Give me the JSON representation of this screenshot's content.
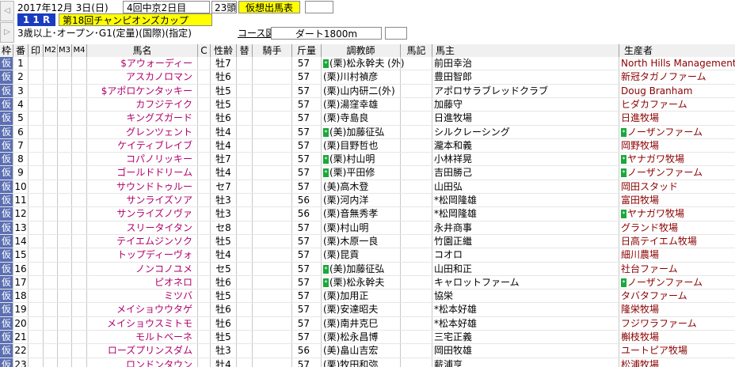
{
  "header": {
    "date": "2017年12月 3日(日)",
    "meeting": "4回中京2日目",
    "count": "23頭",
    "mode_button": "仮想出馬表",
    "race_no": "1 1 R",
    "race_name": "第18回チャンピオンズカップ",
    "conditions": "3歳以上･オープン･G1(定量)(国際)(指定)",
    "course_button": "コース図",
    "course": "ダート1800m"
  },
  "columns": {
    "waku": "枠",
    "ban": "番",
    "shirushi": "印",
    "m2": "M2",
    "m3": "M3",
    "m4": "M4",
    "horse": "馬名",
    "c": "C",
    "sex_age": "性齢",
    "replace": "替",
    "jockey": "騎手",
    "weight": "斤量",
    "trainer": "調教師",
    "banki": "馬記",
    "owner": "馬主",
    "breeder": "生産者"
  },
  "rows": [
    {
      "waku": "仮",
      "no": "1",
      "prefix": "$",
      "horse": "アウォーディー",
      "sex": "牡7",
      "weight": "57",
      "mark": "*",
      "trainer": "(栗)松永幹夫 (外)",
      "owner": "前田幸治",
      "bmark": "",
      "breeder": "North Hills Management"
    },
    {
      "waku": "仮",
      "no": "2",
      "prefix": "",
      "horse": "アスカノロマン",
      "sex": "牡6",
      "weight": "57",
      "mark": "",
      "trainer": "(栗)川村禎彦",
      "owner": "豊田智郎",
      "bmark": "",
      "breeder": "新冠タガノファーム"
    },
    {
      "waku": "仮",
      "no": "3",
      "prefix": "$",
      "horse": "アポロケンタッキー",
      "sex": "牡5",
      "weight": "57",
      "mark": "",
      "trainer": "(栗)山内研二(外)",
      "owner": "アポロサラブレッドクラブ",
      "bmark": "",
      "breeder": "Doug Branham"
    },
    {
      "waku": "仮",
      "no": "4",
      "prefix": "",
      "horse": "カフジテイク",
      "sex": "牡5",
      "weight": "57",
      "mark": "",
      "trainer": "(栗)湯窪幸雄",
      "owner": "加藤守",
      "bmark": "",
      "breeder": "ヒダカファーム"
    },
    {
      "waku": "仮",
      "no": "5",
      "prefix": "",
      "horse": "キングズガード",
      "sex": "牡6",
      "weight": "57",
      "mark": "",
      "trainer": "(栗)寺島良",
      "owner": "日進牧場",
      "bmark": "",
      "breeder": "日進牧場"
    },
    {
      "waku": "仮",
      "no": "6",
      "prefix": "",
      "horse": "グレンツェント",
      "sex": "牡4",
      "weight": "57",
      "mark": "*",
      "trainer": "(美)加藤征弘",
      "owner": "シルクレーシング",
      "bmark": "*",
      "breeder": "ノーザンファーム"
    },
    {
      "waku": "仮",
      "no": "7",
      "prefix": "",
      "horse": "ケイティブレイブ",
      "sex": "牡4",
      "weight": "57",
      "mark": "",
      "trainer": "(栗)目野哲也",
      "owner": "瀧本和義",
      "bmark": "",
      "breeder": "岡野牧場"
    },
    {
      "waku": "仮",
      "no": "8",
      "prefix": "",
      "horse": "コパノリッキー",
      "sex": "牡7",
      "weight": "57",
      "mark": "*",
      "trainer": "(栗)村山明",
      "owner": "小林祥晃",
      "bmark": "*",
      "breeder": "ヤナガワ牧場"
    },
    {
      "waku": "仮",
      "no": "9",
      "prefix": "",
      "horse": "ゴールドドリーム",
      "sex": "牡4",
      "weight": "57",
      "mark": "*",
      "trainer": "(栗)平田修",
      "owner": "吉田勝己",
      "bmark": "*",
      "breeder": "ノーザンファーム"
    },
    {
      "waku": "仮",
      "no": "10",
      "prefix": "",
      "horse": "サウンドトゥルー",
      "sex": "セ7",
      "weight": "57",
      "mark": "",
      "trainer": "(美)高木登",
      "owner": "山田弘",
      "bmark": "",
      "breeder": "岡田スタッド"
    },
    {
      "waku": "仮",
      "no": "11",
      "prefix": "",
      "horse": "サンライズソア",
      "sex": "牡3",
      "weight": "56",
      "mark": "",
      "trainer": "(栗)河内洋",
      "owner": "*松岡隆雄",
      "bmark": "",
      "breeder": "富田牧場"
    },
    {
      "waku": "仮",
      "no": "12",
      "prefix": "",
      "horse": "サンライズノヴァ",
      "sex": "牡3",
      "weight": "56",
      "mark": "",
      "trainer": "(栗)音無秀孝",
      "owner": "*松岡隆雄",
      "bmark": "*",
      "breeder": "ヤナガワ牧場"
    },
    {
      "waku": "仮",
      "no": "13",
      "prefix": "",
      "horse": "スリータイタン",
      "sex": "セ8",
      "weight": "57",
      "mark": "",
      "trainer": "(栗)村山明",
      "owner": "永井商事",
      "bmark": "",
      "breeder": "グランド牧場"
    },
    {
      "waku": "仮",
      "no": "14",
      "prefix": "",
      "horse": "テイエムジンソク",
      "sex": "牡5",
      "weight": "57",
      "mark": "",
      "trainer": "(栗)木原一良",
      "owner": "竹園正繼",
      "bmark": "",
      "breeder": "日高テイエム牧場"
    },
    {
      "waku": "仮",
      "no": "15",
      "prefix": "",
      "horse": "トップディーヴォ",
      "sex": "牡4",
      "weight": "57",
      "mark": "",
      "trainer": "(栗)昆貢",
      "owner": "コオロ",
      "bmark": "",
      "breeder": "細川農場"
    },
    {
      "waku": "仮",
      "no": "16",
      "prefix": "",
      "horse": "ノンコノユメ",
      "sex": "セ5",
      "weight": "57",
      "mark": "*",
      "trainer": "(美)加藤征弘",
      "owner": "山田和正",
      "bmark": "",
      "breeder": "社台ファーム"
    },
    {
      "waku": "仮",
      "no": "17",
      "prefix": "",
      "horse": "ピオネロ",
      "sex": "牡6",
      "weight": "57",
      "mark": "*",
      "trainer": "(栗)松永幹夫",
      "owner": "キャロットファーム",
      "bmark": "*",
      "breeder": "ノーザンファーム"
    },
    {
      "waku": "仮",
      "no": "18",
      "prefix": "",
      "horse": "ミツバ",
      "sex": "牡5",
      "weight": "57",
      "mark": "",
      "trainer": "(栗)加用正",
      "owner": "協栄",
      "bmark": "",
      "breeder": "タバタファーム"
    },
    {
      "waku": "仮",
      "no": "19",
      "prefix": "",
      "horse": "メイショウウタゲ",
      "sex": "牡6",
      "weight": "57",
      "mark": "",
      "trainer": "(栗)安達昭夫",
      "owner": "*松本好雄",
      "bmark": "",
      "breeder": "隆栄牧場"
    },
    {
      "waku": "仮",
      "no": "20",
      "prefix": "",
      "horse": "メイショウスミトモ",
      "sex": "牡6",
      "weight": "57",
      "mark": "",
      "trainer": "(栗)南井克巳",
      "owner": "*松本好雄",
      "bmark": "",
      "breeder": "フジワラファーム"
    },
    {
      "waku": "仮",
      "no": "21",
      "prefix": "",
      "horse": "モルトベーネ",
      "sex": "牡5",
      "weight": "57",
      "mark": "",
      "trainer": "(栗)松永昌博",
      "owner": "三宅正義",
      "bmark": "",
      "breeder": "槲枝牧場"
    },
    {
      "waku": "仮",
      "no": "22",
      "prefix": "",
      "horse": "ローズプリンスダム",
      "sex": "牡3",
      "weight": "56",
      "mark": "",
      "trainer": "(美)畠山吉宏",
      "owner": "岡田牧雄",
      "bmark": "",
      "breeder": "ユートピア牧場"
    },
    {
      "waku": "仮",
      "no": "23",
      "prefix": "",
      "horse": "ロンドンタウン",
      "sex": "牡4",
      "weight": "57",
      "mark": "",
      "trainer": "(栗)牧田和弥",
      "owner": "薪浦亨",
      "bmark": "",
      "breeder": "松浦牧場"
    }
  ]
}
